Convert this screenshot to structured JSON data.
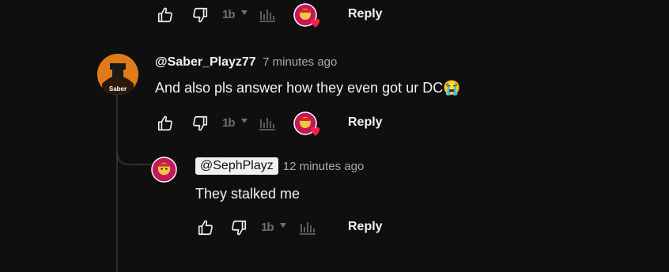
{
  "comments": [
    {
      "author": "",
      "time": "",
      "text": "",
      "actions": {
        "reply_label": "Reply",
        "tb_label": "1b"
      }
    },
    {
      "author": "@Saber_Playz77",
      "time": "7 minutes ago",
      "text": "And also pls answer how they even got ur DC",
      "emoji": "😭",
      "avatar_label": "Saber",
      "actions": {
        "reply_label": "Reply",
        "tb_label": "1b"
      }
    },
    {
      "mention": "@SephPlayz",
      "time": "12 minutes ago",
      "text": "They stalked me",
      "actions": {
        "reply_label": "Reply",
        "tb_label": "1b"
      }
    }
  ],
  "colors": {
    "background": "#0f0f0f",
    "text": "#f1f1f1",
    "muted": "#aaaaaa",
    "dim_icon": "#6e6e6e",
    "heart": "#ff1f4d",
    "avatar_pink": "#c2185b"
  },
  "icons": [
    "like-icon",
    "dislike-icon",
    "tb-icon",
    "stats-icon",
    "heart-avatar",
    "thread-line"
  ]
}
